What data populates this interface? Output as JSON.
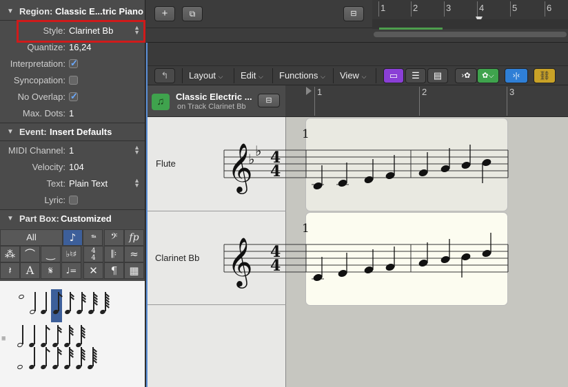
{
  "inspector": {
    "region": {
      "label": "Region:",
      "value": "Classic E...tric Piano"
    },
    "rows": [
      {
        "label": "Style:",
        "value": "Clarinet Bb"
      },
      {
        "label": "Quantize:",
        "value": "16,24"
      },
      {
        "label": "Interpretation:",
        "checked": true
      },
      {
        "label": "Syncopation:",
        "checked": false
      },
      {
        "label": "No Overlap:",
        "checked": true
      },
      {
        "label": "Max. Dots:",
        "value": "1"
      }
    ],
    "event": {
      "label": "Event:",
      "value": "Insert Defaults"
    },
    "event_rows": [
      {
        "label": "MIDI Channel:",
        "value": "1"
      },
      {
        "label": "Velocity:",
        "value": "104"
      },
      {
        "label": "Text:",
        "value": "Plain Text"
      },
      {
        "label": "Lyric:",
        "checked": false
      }
    ],
    "partbox": {
      "label": "Part Box:",
      "value": "Customized",
      "all_label": "All"
    },
    "palette_row2": [
      "𝄋",
      "𝄐",
      "⌒",
      "♭♮♯",
      "4/4",
      "𝄃",
      "𝄽"
    ],
    "palette_row3": [
      "𝆢",
      "A",
      "𝄋",
      "♩=",
      "✕",
      "¶",
      "▦"
    ],
    "palette_row1": [
      "♪/3",
      "Ped.",
      "𝄢",
      "fp"
    ]
  },
  "top_track": {
    "add_button": "+",
    "ruler_numbers": [
      "1",
      "2",
      "3",
      "4",
      "5",
      "6"
    ]
  },
  "edit_bar": {
    "menus": [
      "Layout",
      "Edit",
      "Functions",
      "View"
    ]
  },
  "region_header": {
    "title": "Classic Electric ...",
    "subtitle": "on Track Clarinet Bb"
  },
  "score_ruler": [
    "1",
    "2",
    "3"
  ],
  "staves": [
    {
      "name": "Flute",
      "measure_number": "1",
      "time_sig_top": "4",
      "time_sig_bottom": "4"
    },
    {
      "name": "Clarinet Bb",
      "measure_number": "1",
      "time_sig_top": "4",
      "time_sig_bottom": "4"
    }
  ],
  "colors": {
    "highlight": "#d01a1a",
    "selected_cell": "#3d5f9a",
    "purple_button": "#8a3fd6",
    "green_button": "#3fa34d",
    "blue_button": "#2f7fd6",
    "yellow_button": "#c9a227"
  }
}
